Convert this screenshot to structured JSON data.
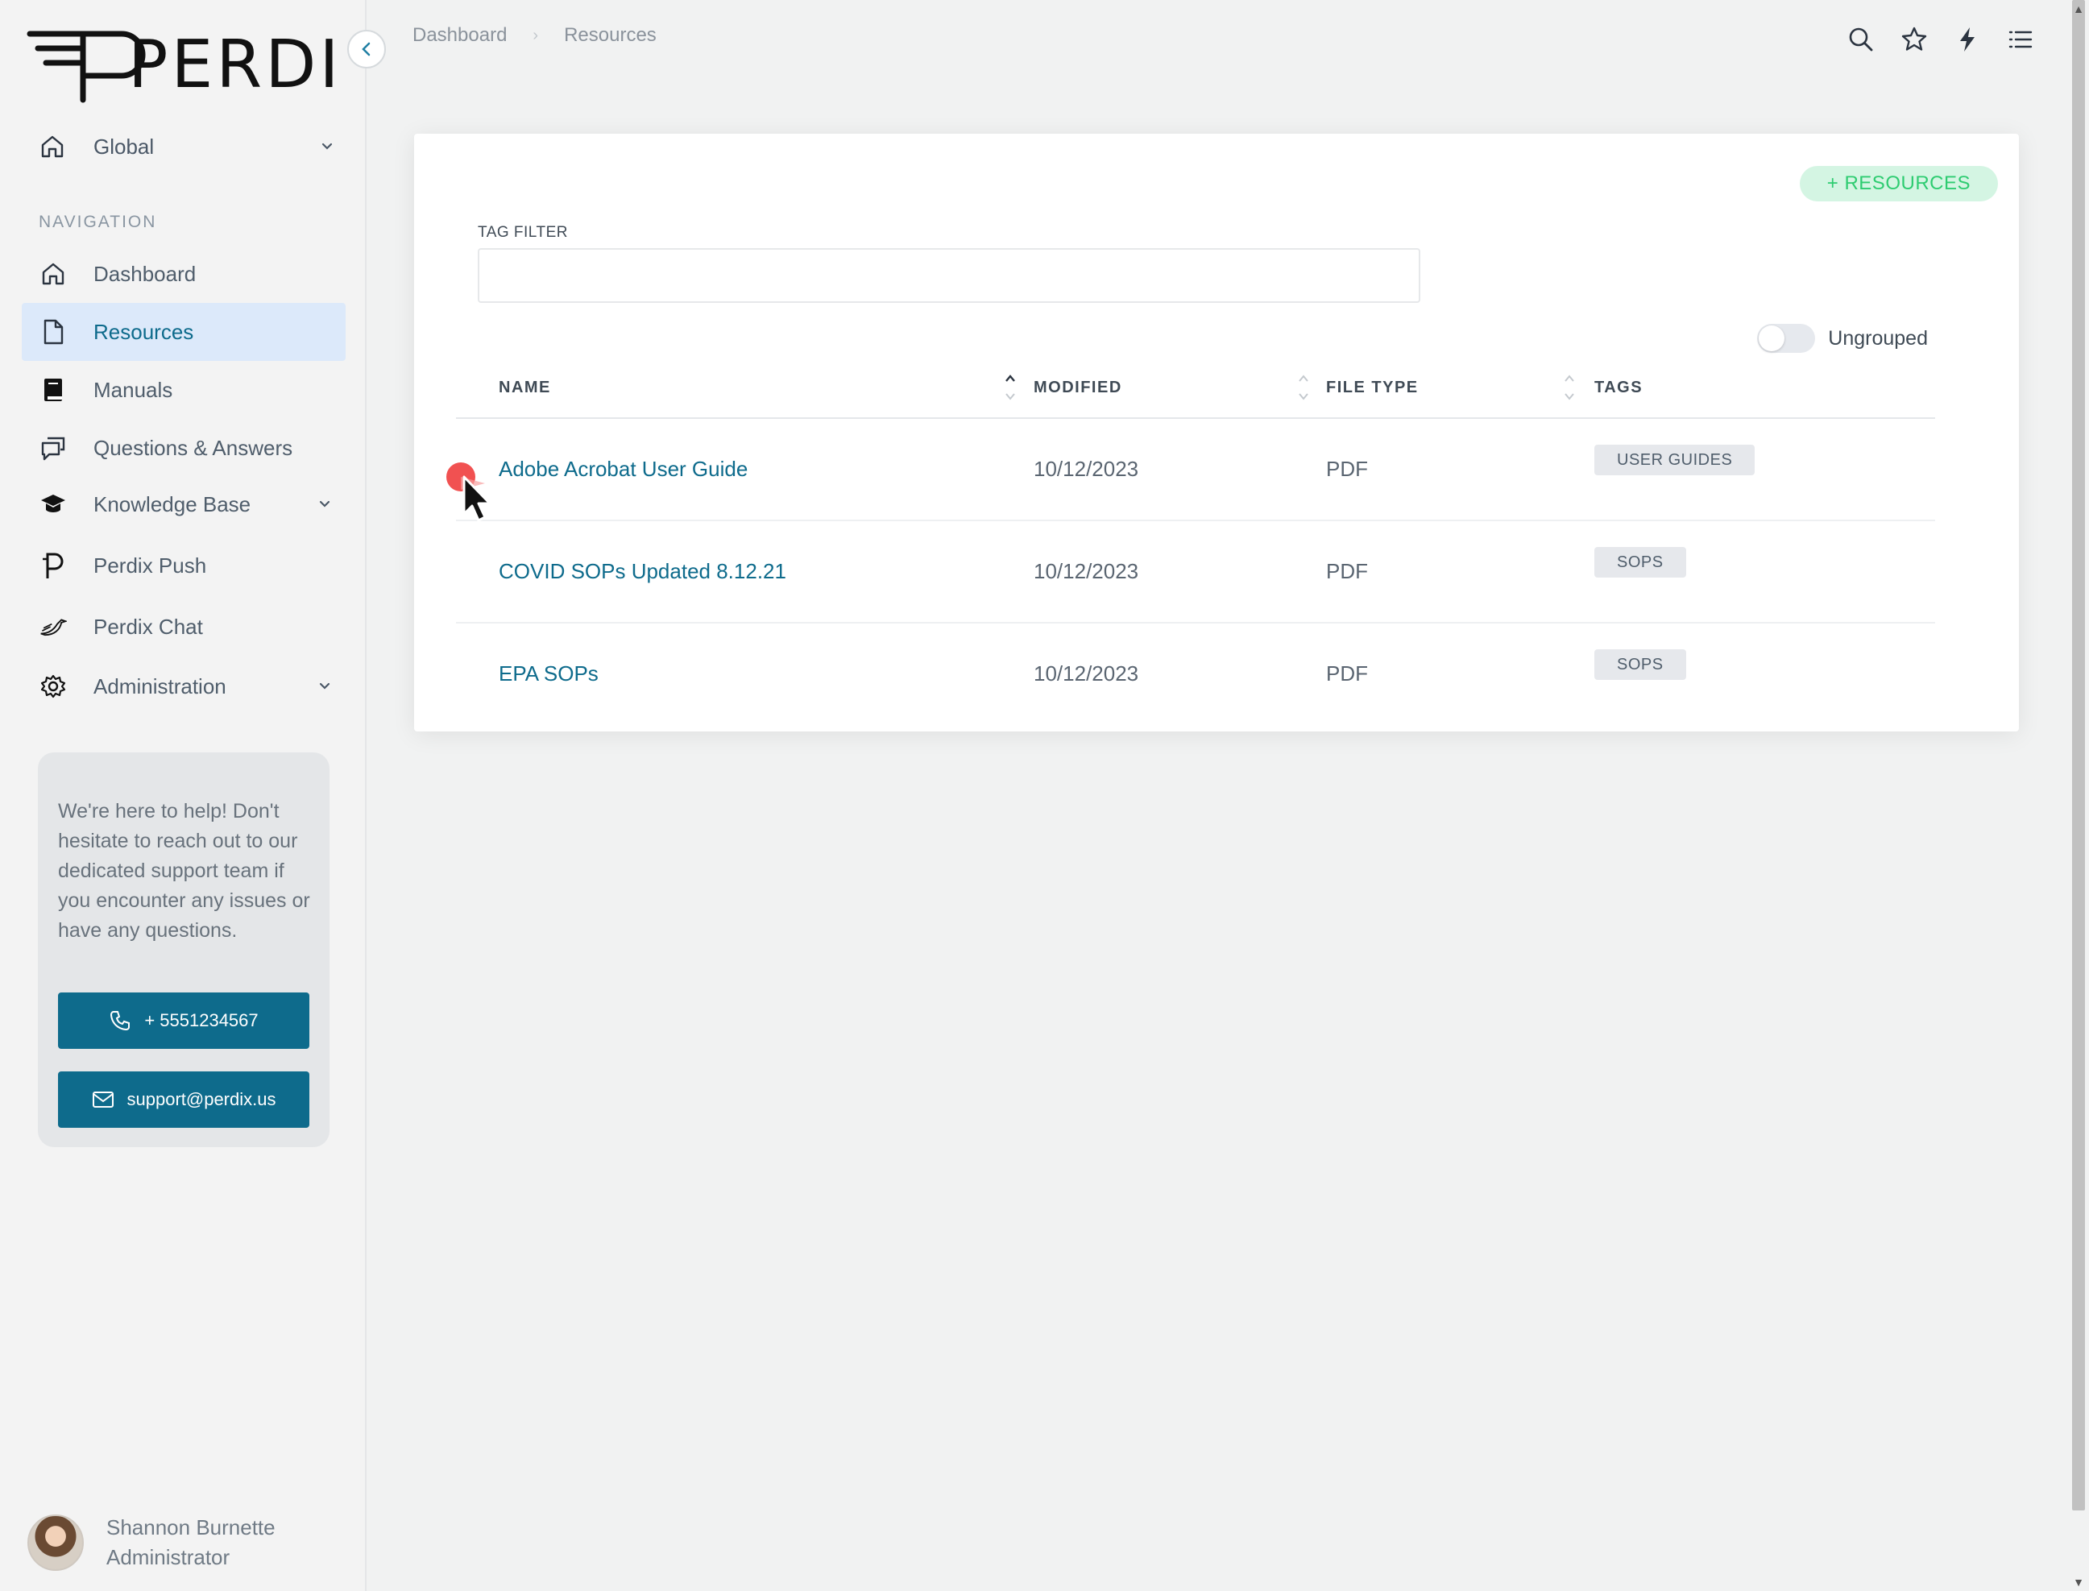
{
  "brand": {
    "name": "PERDIX"
  },
  "sidebar": {
    "global": {
      "label": "Global",
      "icon": "home-icon"
    },
    "nav_heading": "NAVIGATION",
    "items": [
      {
        "label": "Dashboard",
        "icon": "home-icon",
        "active": false,
        "has_children": false
      },
      {
        "label": "Resources",
        "icon": "file-icon",
        "active": true,
        "has_children": false
      },
      {
        "label": "Manuals",
        "icon": "book-icon",
        "active": false,
        "has_children": false
      },
      {
        "label": "Questions & Answers",
        "icon": "chat-icon",
        "active": false,
        "has_children": false
      },
      {
        "label": "Knowledge Base",
        "icon": "graduation-cap-icon",
        "active": false,
        "has_children": true
      },
      {
        "label": "Perdix Push",
        "icon": "perdix-p-icon",
        "active": false,
        "has_children": false
      },
      {
        "label": "Perdix Chat",
        "icon": "bird-icon",
        "active": false,
        "has_children": false
      },
      {
        "label": "Administration",
        "icon": "gear-icon",
        "active": false,
        "has_children": true
      }
    ],
    "help": {
      "text": "We're here to help! Don't hesitate to reach out to our dedicated support team if you encounter any issues or have any questions.",
      "phone": "+ 5551234567",
      "email": "support@perdix.us"
    },
    "user": {
      "name": "Shannon Burnette",
      "role": "Administrator"
    }
  },
  "breadcrumb": [
    "Dashboard",
    "Resources"
  ],
  "toolbar_icons": [
    "search-icon",
    "star-icon",
    "bolt-icon",
    "list-icon"
  ],
  "main": {
    "add_button": "+ RESOURCES",
    "tag_filter": {
      "label": "TAG FILTER",
      "value": "",
      "placeholder": ""
    },
    "toggle": {
      "label": "Ungrouped",
      "on": false
    },
    "table": {
      "columns": [
        "NAME",
        "MODIFIED",
        "FILE TYPE",
        "TAGS"
      ],
      "sort": {
        "column": "NAME",
        "direction": "asc"
      },
      "rows": [
        {
          "name": "Adobe Acrobat User Guide",
          "modified": "10/12/2023",
          "file_type": "PDF",
          "tag": "USER GUIDES"
        },
        {
          "name": "COVID SOPs Updated 8.12.21",
          "modified": "10/12/2023",
          "file_type": "PDF",
          "tag": "SOPS"
        },
        {
          "name": "EPA SOPs",
          "modified": "10/12/2023",
          "file_type": "PDF",
          "tag": "SOPS"
        }
      ]
    }
  },
  "colors": {
    "accent": "#0e6b8c",
    "active_bg": "#dce9fa",
    "add_button_bg": "#d4f5e3",
    "add_button_text": "#2ecc71",
    "cursor_marker": "#f04848"
  }
}
